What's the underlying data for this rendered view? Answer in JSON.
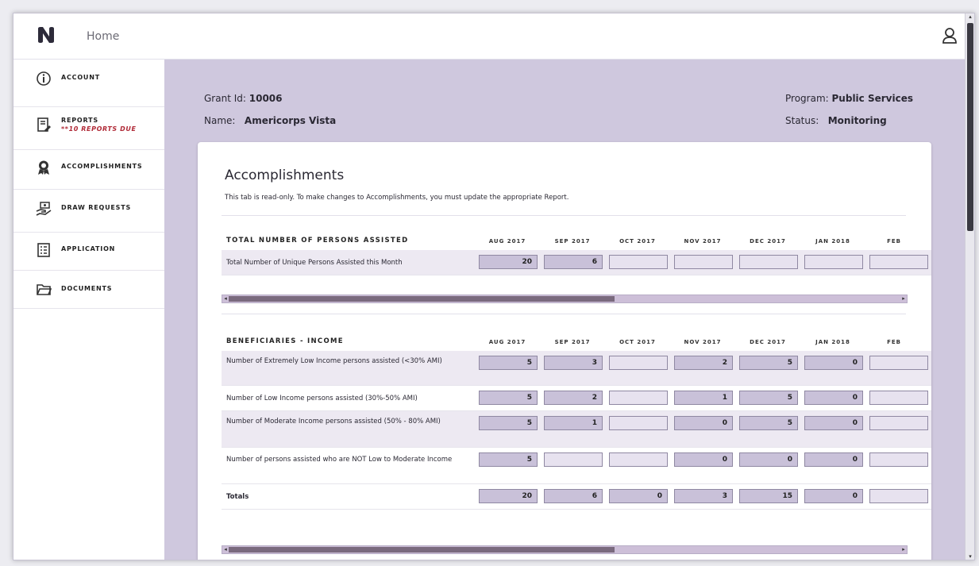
{
  "header": {
    "home_label": "Home"
  },
  "sidebar": {
    "items": [
      {
        "label": "ACCOUNT",
        "sub": ""
      },
      {
        "label": "REPORTS",
        "sub": "**10 REPORTS DUE"
      },
      {
        "label": "ACCOMPLISHMENTS",
        "sub": ""
      },
      {
        "label": "DRAW REQUESTS",
        "sub": ""
      },
      {
        "label": "APPLICATION",
        "sub": ""
      },
      {
        "label": "DOCUMENTS",
        "sub": ""
      }
    ]
  },
  "grant": {
    "id_label": "Grant Id:",
    "id_value": "10006",
    "name_label": "Name:",
    "name_value": "Americorps Vista",
    "program_label": "Program:",
    "program_value": "Public Services",
    "status_label": "Status:",
    "status_value": "Monitoring"
  },
  "page": {
    "title": "Accomplishments",
    "description": "This tab is read-only.  To make changes to Accomplishments, you must update the appropriate Report."
  },
  "sections": [
    {
      "title": "TOTAL NUMBER OF PERSONS ASSISTED",
      "columns": [
        "AUG 2017",
        "SEP 2017",
        "OCT 2017",
        "NOV 2017",
        "DEC 2017",
        "JAN 2018",
        "FEB"
      ],
      "rows": [
        {
          "label": "Total Number of Unique Persons Assisted this Month",
          "values": [
            "20",
            "6",
            "",
            "",
            "",
            "",
            ""
          ]
        }
      ]
    },
    {
      "title": "BENEFICIARIES - INCOME",
      "columns": [
        "AUG 2017",
        "SEP 2017",
        "OCT 2017",
        "NOV 2017",
        "DEC 2017",
        "JAN 2018",
        "FEB"
      ],
      "rows": [
        {
          "label": "Number of Extremely Low Income persons assisted (<30% AMI)",
          "values": [
            "5",
            "3",
            "",
            "2",
            "5",
            "0",
            ""
          ]
        },
        {
          "label": "Number of Low Income persons assisted (30%-50% AMI)",
          "values": [
            "5",
            "2",
            "",
            "1",
            "5",
            "0",
            ""
          ]
        },
        {
          "label": "Number of Moderate Income persons assisted (50% - 80% AMI)",
          "values": [
            "5",
            "1",
            "",
            "0",
            "5",
            "0",
            ""
          ]
        },
        {
          "label": "Number of persons assisted who are NOT Low to Moderate Income",
          "values": [
            "5",
            "",
            "",
            "0",
            "0",
            "0",
            ""
          ]
        },
        {
          "label": "Totals",
          "values": [
            "20",
            "6",
            "0",
            "3",
            "15",
            "0",
            ""
          ]
        }
      ]
    }
  ]
}
